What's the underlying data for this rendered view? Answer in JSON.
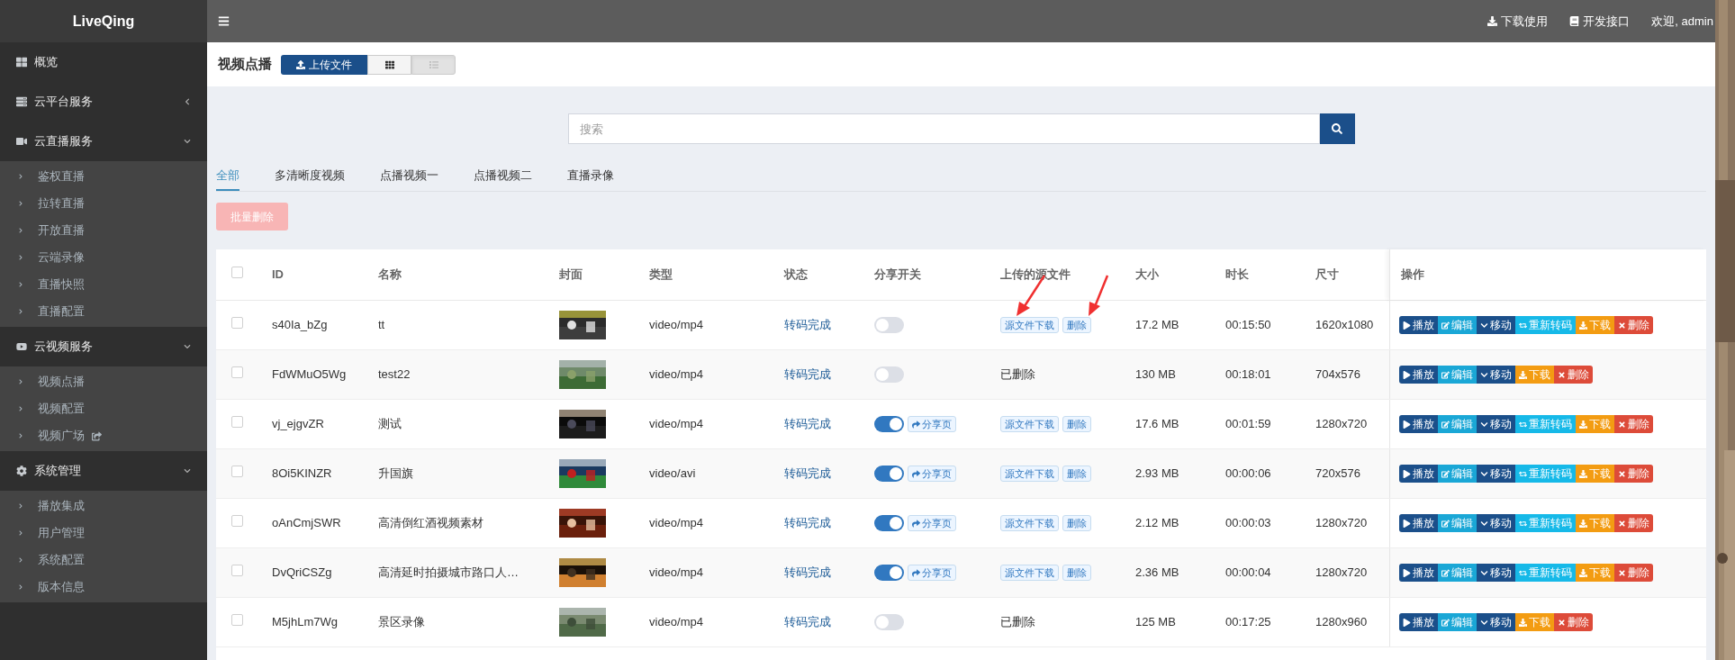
{
  "topbar": {
    "logo": "LiveQing",
    "links": [
      {
        "kind": "download",
        "label": "下载使用"
      },
      {
        "kind": "book",
        "label": "开发接口"
      }
    ],
    "user": "欢迎, admin"
  },
  "sidebar": {
    "items": [
      {
        "kind": "grid",
        "label": "概览"
      },
      {
        "kind": "server",
        "label": "云平台服务",
        "expanded": false
      },
      {
        "kind": "video",
        "label": "云直播服务",
        "expanded": true,
        "children": [
          {
            "label": "鉴权直播"
          },
          {
            "label": "拉转直播"
          },
          {
            "label": "开放直播"
          },
          {
            "label": "云端录像"
          },
          {
            "label": "直播快照"
          },
          {
            "label": "直播配置"
          }
        ]
      },
      {
        "kind": "youtube",
        "label": "云视频服务",
        "expanded": true,
        "children": [
          {
            "label": "视频点播"
          },
          {
            "label": "视频配置"
          },
          {
            "label": "视频广场",
            "external": true
          }
        ]
      },
      {
        "kind": "cog",
        "label": "系统管理",
        "expanded": true,
        "children": [
          {
            "label": "播放集成"
          },
          {
            "label": "用户管理"
          },
          {
            "label": "系统配置"
          },
          {
            "label": "版本信息"
          }
        ]
      }
    ]
  },
  "page": {
    "title": "视频点播",
    "upload_button": "上传文件",
    "view_modes": [
      {
        "kind": "grid",
        "selected": false
      },
      {
        "kind": "list",
        "selected": true
      }
    ]
  },
  "search": {
    "placeholder": "搜索"
  },
  "tabs": [
    {
      "label": "全部",
      "selected": true
    },
    {
      "label": "多清晰度视频",
      "selected": false
    },
    {
      "label": "点播视频一",
      "selected": false
    },
    {
      "label": "点播视频二",
      "selected": false
    },
    {
      "label": "直播录像",
      "selected": false
    }
  ],
  "batch_delete": {
    "label": "批量删除",
    "disabled": true
  },
  "table": {
    "select_all_checked": false,
    "columns": [
      "ID",
      "名称",
      "封面",
      "类型",
      "状态",
      "分享开关",
      "上传的源文件",
      "大小",
      "时长",
      "尺寸",
      "操作"
    ],
    "rows": [
      {
        "checked": false,
        "id": "s40Ia_bZg",
        "name": "tt",
        "type": "video/mp4",
        "status": "转码完成",
        "share": {
          "on": false
        },
        "source": {
          "kind": "file",
          "download": "源文件下载",
          "delete": "删除"
        },
        "size": "17.2 MB",
        "duration": "00:15:50",
        "dimensions": "1620x1080",
        "actions": [
          {
            "kind": "play",
            "label": "播放"
          },
          {
            "kind": "edit",
            "label": "编辑"
          },
          {
            "kind": "move",
            "label": "移动"
          },
          {
            "kind": "transcode",
            "label": "重新转码"
          },
          {
            "kind": "download",
            "label": "下载"
          },
          {
            "kind": "delete",
            "label": "删除"
          }
        ]
      },
      {
        "checked": false,
        "id": "FdWMuO5Wg",
        "name": "test22",
        "type": "video/mp4",
        "status": "转码完成",
        "share": {
          "on": false
        },
        "source": {
          "kind": "deleted",
          "text": "已删除"
        },
        "size": "130 MB",
        "duration": "00:18:01",
        "dimensions": "704x576",
        "actions": [
          {
            "kind": "play",
            "label": "播放"
          },
          {
            "kind": "edit",
            "label": "编辑"
          },
          {
            "kind": "move",
            "label": "移动"
          },
          {
            "kind": "download",
            "label": "下载"
          },
          {
            "kind": "delete",
            "label": "删除"
          }
        ]
      },
      {
        "checked": false,
        "id": "vj_ejgvZR",
        "name": "测试",
        "type": "video/mp4",
        "status": "转码完成",
        "share": {
          "on": true,
          "link": "分享页"
        },
        "source": {
          "kind": "file",
          "download": "源文件下载",
          "delete": "删除"
        },
        "size": "17.6 MB",
        "duration": "00:01:59",
        "dimensions": "1280x720",
        "actions": [
          {
            "kind": "play",
            "label": "播放"
          },
          {
            "kind": "edit",
            "label": "编辑"
          },
          {
            "kind": "move",
            "label": "移动"
          },
          {
            "kind": "transcode",
            "label": "重新转码"
          },
          {
            "kind": "download",
            "label": "下载"
          },
          {
            "kind": "delete",
            "label": "删除"
          }
        ]
      },
      {
        "checked": false,
        "id": "8Oi5KINZR",
        "name": "升国旗",
        "type": "video/avi",
        "status": "转码完成",
        "share": {
          "on": true,
          "link": "分享页"
        },
        "source": {
          "kind": "file",
          "download": "源文件下载",
          "delete": "删除"
        },
        "size": "2.93 MB",
        "duration": "00:00:06",
        "dimensions": "720x576",
        "actions": [
          {
            "kind": "play",
            "label": "播放"
          },
          {
            "kind": "edit",
            "label": "编辑"
          },
          {
            "kind": "move",
            "label": "移动"
          },
          {
            "kind": "transcode",
            "label": "重新转码"
          },
          {
            "kind": "download",
            "label": "下载"
          },
          {
            "kind": "delete",
            "label": "删除"
          }
        ]
      },
      {
        "checked": false,
        "id": "oAnCmjSWR",
        "name": "高清倒红酒视频素材",
        "type": "video/mp4",
        "status": "转码完成",
        "share": {
          "on": true,
          "link": "分享页"
        },
        "source": {
          "kind": "file",
          "download": "源文件下载",
          "delete": "删除"
        },
        "size": "2.12 MB",
        "duration": "00:00:03",
        "dimensions": "1280x720",
        "actions": [
          {
            "kind": "play",
            "label": "播放"
          },
          {
            "kind": "edit",
            "label": "编辑"
          },
          {
            "kind": "move",
            "label": "移动"
          },
          {
            "kind": "transcode",
            "label": "重新转码"
          },
          {
            "kind": "download",
            "label": "下载"
          },
          {
            "kind": "delete",
            "label": "删除"
          }
        ]
      },
      {
        "checked": false,
        "id": "DvQriCSZg",
        "name": "高清延时拍摄城市路口人…",
        "type": "video/mp4",
        "status": "转码完成",
        "share": {
          "on": true,
          "link": "分享页"
        },
        "source": {
          "kind": "file",
          "download": "源文件下载",
          "delete": "删除"
        },
        "size": "2.36 MB",
        "duration": "00:00:04",
        "dimensions": "1280x720",
        "actions": [
          {
            "kind": "play",
            "label": "播放"
          },
          {
            "kind": "edit",
            "label": "编辑"
          },
          {
            "kind": "move",
            "label": "移动"
          },
          {
            "kind": "transcode",
            "label": "重新转码"
          },
          {
            "kind": "download",
            "label": "下载"
          },
          {
            "kind": "delete",
            "label": "删除"
          }
        ]
      },
      {
        "checked": false,
        "id": "M5jhLm7Wg",
        "name": "景区录像",
        "type": "video/mp4",
        "status": "转码完成",
        "share": {
          "on": false
        },
        "source": {
          "kind": "deleted",
          "text": "已删除"
        },
        "size": "125 MB",
        "duration": "00:17:25",
        "dimensions": "1280x960",
        "actions": [
          {
            "kind": "play",
            "label": "播放"
          },
          {
            "kind": "edit",
            "label": "编辑"
          },
          {
            "kind": "move",
            "label": "移动"
          },
          {
            "kind": "download",
            "label": "下载"
          },
          {
            "kind": "delete",
            "label": "删除"
          }
        ]
      }
    ]
  }
}
